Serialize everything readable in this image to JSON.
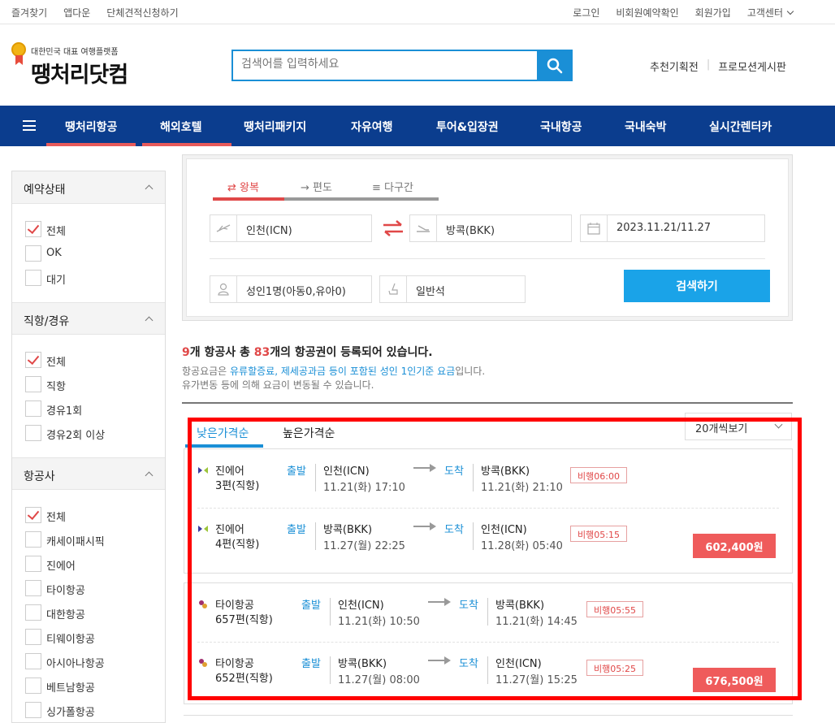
{
  "topbar": {
    "left": [
      "즐겨찾기",
      "앱다운",
      "단체견적신청하기"
    ],
    "right": [
      "로그인",
      "비회원예약확인",
      "회원가입",
      "고객센터"
    ]
  },
  "logo": {
    "tagline": "대한민국 대표 여행플랫폼",
    "name": "땡처리닷컴"
  },
  "search": {
    "placeholder": "검색어를 입력하세요"
  },
  "header_links": [
    "추천기획전",
    "프로모션게시판"
  ],
  "nav": [
    "땡처리항공",
    "해외호텔",
    "땡처리패키지",
    "자유여행",
    "투어&입장권",
    "국내항공",
    "국내숙박",
    "실시간렌터카"
  ],
  "filters": {
    "status": {
      "title": "예약상태",
      "options": [
        "전체",
        "OK",
        "대기"
      ]
    },
    "stops": {
      "title": "직항/경유",
      "options": [
        "전체",
        "직항",
        "경유1회",
        "경유2회 이상"
      ]
    },
    "airline": {
      "title": "항공사",
      "options": [
        "전체",
        "캐세이패시픽",
        "진에어",
        "타이항공",
        "대한항공",
        "티웨이항공",
        "아시아나항공",
        "베트남항공",
        "싱가폴항공"
      ]
    }
  },
  "search_box": {
    "trip_tabs": [
      "왕복",
      "편도",
      "다구간"
    ],
    "from": "인천(ICN)",
    "to": "방콕(BKK)",
    "dates": "2023.11.21/11.27",
    "passengers": "성인1명(아동0,유아0)",
    "cabin": "일반석",
    "search_button": "검색하기"
  },
  "summary": {
    "airline_count": "9",
    "text1": "개 항공사 총 ",
    "ticket_count": "83",
    "text2": "개의 항공권이 등록되어 있습니다.",
    "note1_a": "항공요금은 ",
    "note1_b": "유류할증료, 제세공과금 등이 포함된 성인 1인기준 요금",
    "note1_c": "입니다.",
    "note2": "유가변동 등에 의해 요금이 변동될 수 있습니다."
  },
  "sort": {
    "tabs": [
      "낮은가격순",
      "높은가격순"
    ],
    "per_page": "20개씩보기"
  },
  "results": [
    {
      "price": "602,400원",
      "legs": [
        {
          "airline": "진에어",
          "flight": "3편(직항)",
          "dep_label": "출발",
          "from": "인천(ICN)",
          "dep_time": "11.21(화) 17:10",
          "arr_label": "도착",
          "to": "방콕(BKK)",
          "arr_time": "11.21(화) 21:10",
          "duration": "비행06:00"
        },
        {
          "airline": "진에어",
          "flight": "4편(직항)",
          "dep_label": "출발",
          "from": "방콕(BKK)",
          "dep_time": "11.27(월) 22:25",
          "arr_label": "도착",
          "to": "인천(ICN)",
          "arr_time": "11.28(화) 05:40",
          "duration": "비행05:15"
        }
      ]
    },
    {
      "price": "676,500원",
      "legs": [
        {
          "airline": "타이항공",
          "flight": "657편(직항)",
          "dep_label": "출발",
          "from": "인천(ICN)",
          "dep_time": "11.21(화) 10:50",
          "arr_label": "도착",
          "to": "방콕(BKK)",
          "arr_time": "11.21(화) 14:45",
          "duration": "비행05:55"
        },
        {
          "airline": "타이항공",
          "flight": "652편(직항)",
          "dep_label": "출발",
          "from": "방콕(BKK)",
          "dep_time": "11.27(월) 08:00",
          "arr_label": "도착",
          "to": "인천(ICN)",
          "arr_time": "11.27(월) 15:25",
          "duration": "비행05:25"
        }
      ]
    }
  ],
  "colors": {
    "brand_nav": "#0b3d8e",
    "accent_red": "#e04848",
    "search_blue": "#1a8fd6",
    "price_bg": "#ef5b5b",
    "highlight_box": "#ff0000"
  }
}
